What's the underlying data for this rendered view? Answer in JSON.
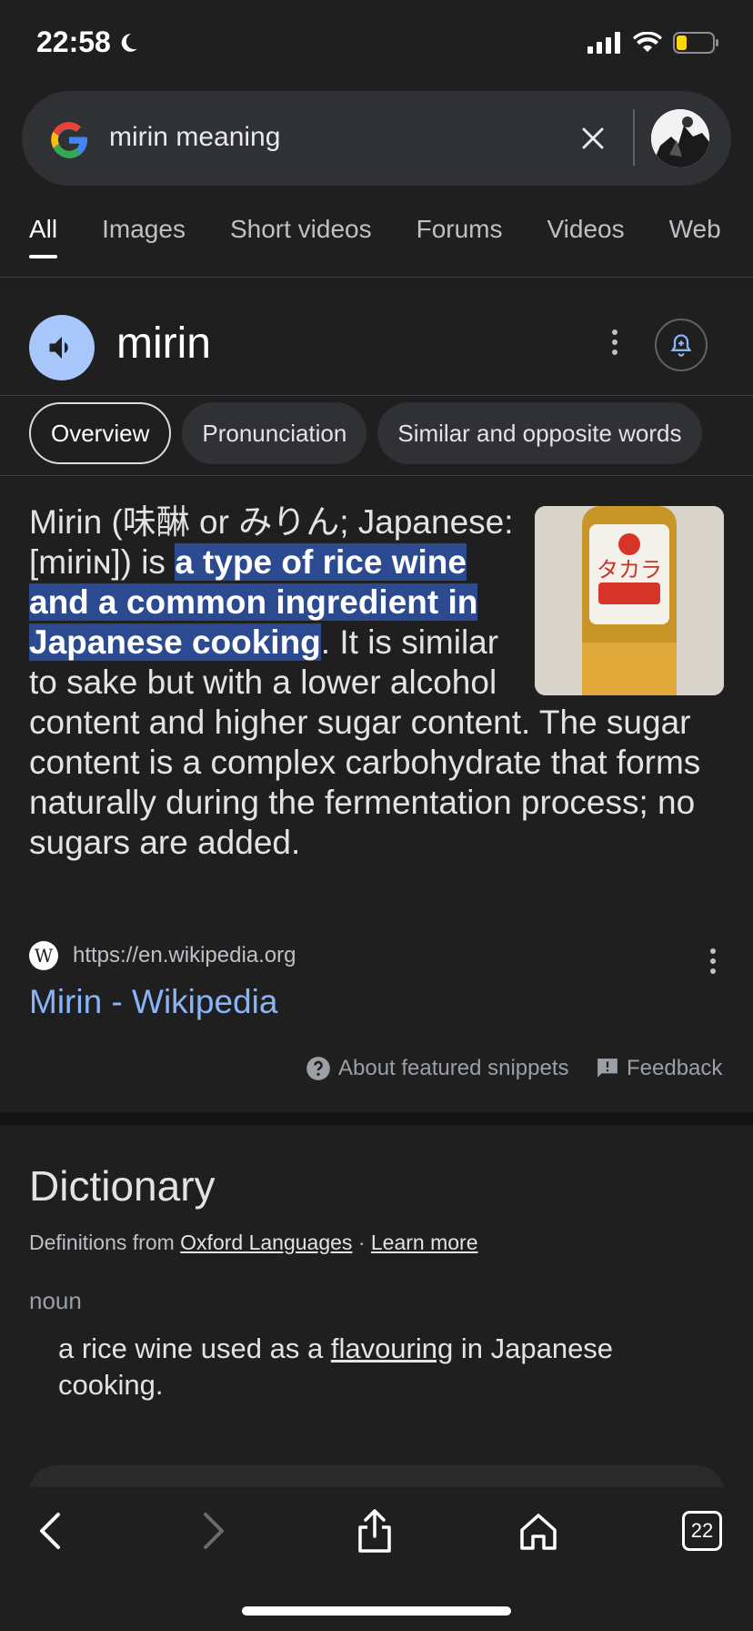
{
  "status": {
    "time": "22:58"
  },
  "search": {
    "query": "mirin meaning"
  },
  "tabs": [
    "All",
    "Images",
    "Short videos",
    "Forums",
    "Videos",
    "Web"
  ],
  "header": {
    "word": "mirin"
  },
  "chips": [
    "Overview",
    "Pronunciation",
    "Similar and opposite words"
  ],
  "snippet": {
    "text_before": "Mirin (味醂 or みりん; Japanese: [miriɴ]) is ",
    "highlight": "a type of rice wine and a common ingredient in Japanese cooking",
    "text_after": ". It is similar to sake but with a lower alcohol content and higher sugar content. The sugar content is a complex carbohydrate that forms naturally during the fermentation process; no sugars are added.",
    "source_url": "https://en.wikipedia.org",
    "source_title": "Mirin - Wikipedia",
    "source_icon_letter": "W",
    "image_label": "タカラ"
  },
  "footer_links": {
    "about": "About featured snippets",
    "feedback": "Feedback"
  },
  "dictionary": {
    "title": "Dictionary",
    "from_label": "Definitions from",
    "provider": "Oxford Languages",
    "separator": "·",
    "learn_more": "Learn more",
    "pos": "noun",
    "def_before": "a rice wine used as a ",
    "def_link": "flavouring",
    "def_after": " in Japanese cooking."
  },
  "toolbar": {
    "tab_count": "22"
  }
}
